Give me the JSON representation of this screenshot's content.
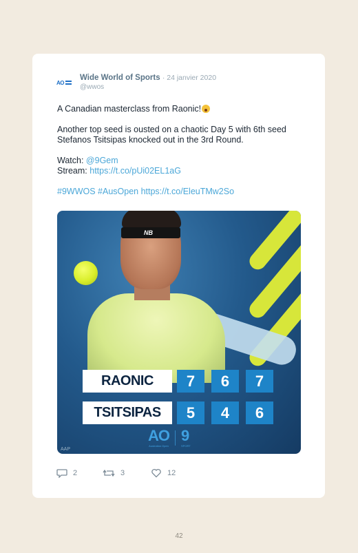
{
  "tweet": {
    "author_name": "Wide World of Sports",
    "date": "· 24 janvier 2020",
    "handle": "@wwos",
    "line1": "A Canadian masterclass from Raonic!",
    "line2a": "Another top seed is ousted on a chaotic Day 5 with 6th seed",
    "line2b": "Stefanos Tsitsipas knocked out in the 3rd Round.",
    "watch_label": "Watch: ",
    "watch_link": "@9Gem",
    "stream_label": "Stream: ",
    "stream_link": "https://t.co/pUi02EL1aG",
    "hashtags": "#9WWOS #AusOpen https://t.co/EleuTMw2So"
  },
  "media": {
    "headband_logo": "NB",
    "players": [
      {
        "name": "RAONIC",
        "sets": [
          "7",
          "6",
          "7"
        ]
      },
      {
        "name": "TSITSIPAS",
        "sets": [
          "5",
          "4",
          "6"
        ]
      }
    ],
    "ao_logo": "AO",
    "ao_sub": "Australian Open",
    "nine_logo": "9",
    "nine_sub": "SPORT",
    "credit": "AAP",
    "colors": {
      "score_blue": "#1e84c8",
      "stripe_yellow": "#d7e63a",
      "bg_blue": "#235a8c"
    }
  },
  "actions": {
    "replies": "2",
    "retweets": "3",
    "likes": "12"
  },
  "page_number": "42"
}
